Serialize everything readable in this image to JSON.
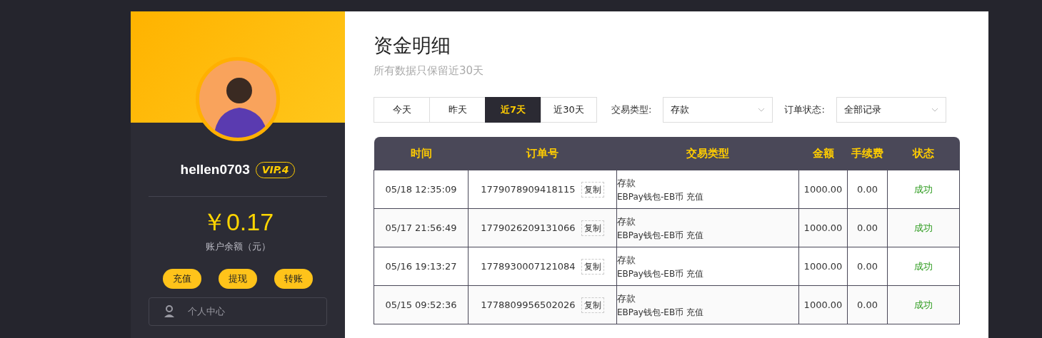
{
  "profile": {
    "username": "hellen0703",
    "vip": "VIP.4",
    "balance": "￥0.17",
    "balance_label": "账户余额（元）",
    "actions": [
      "充值",
      "提现",
      "转账"
    ],
    "menu": [
      {
        "label": "个人中心",
        "kind": "person"
      }
    ]
  },
  "page": {
    "title": "资金明细",
    "subtitle": "所有数据只保留近30天"
  },
  "filters": {
    "ranges": [
      {
        "label": "今天",
        "selected": false
      },
      {
        "label": "昨天",
        "selected": false
      },
      {
        "label": "近7天",
        "selected": true
      },
      {
        "label": "近30天",
        "selected": false
      }
    ],
    "selects": [
      {
        "label": "交易类型:",
        "value": "存款"
      },
      {
        "label": "订单状态:",
        "value": "全部记录"
      }
    ]
  },
  "table": {
    "columns": [
      "时间",
      "订单号",
      "交易类型",
      "金额",
      "手续费",
      "状态"
    ],
    "rows": [
      {
        "time": "05/18 12:35:09",
        "order": "1779078909418115",
        "copy": "复制",
        "type": "存款",
        "detail": "EBPay钱包-EB币 充值",
        "amount": "1000.00",
        "fee": "0.00",
        "status": "成功"
      },
      {
        "time": "05/17 21:56:49",
        "order": "1779026209131066",
        "copy": "复制",
        "type": "存款",
        "detail": "EBPay钱包-EB币 充值",
        "amount": "1000.00",
        "fee": "0.00",
        "status": "成功"
      },
      {
        "time": "05/16 19:13:27",
        "order": "1778930007121084",
        "copy": "复制",
        "type": "存款",
        "detail": "EBPay钱包-EB币 充值",
        "amount": "1000.00",
        "fee": "0.00",
        "status": "成功"
      },
      {
        "time": "05/15 09:52:36",
        "order": "1778809956502026",
        "copy": "复制",
        "type": "存款",
        "detail": "EBPay钱包-EB币 充值",
        "amount": "1000.00",
        "fee": "0.00",
        "status": "成功"
      }
    ]
  }
}
